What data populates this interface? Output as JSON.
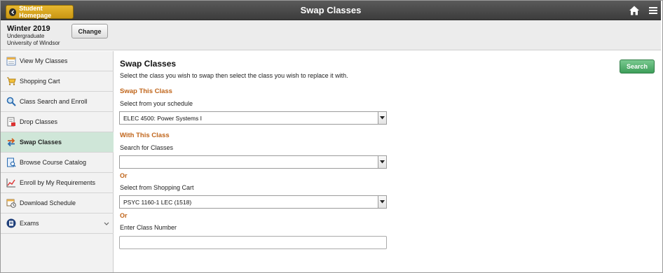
{
  "header": {
    "back_label": "Student Homepage",
    "title": "Swap Classes",
    "home_icon": "home-icon",
    "menu_icon": "hamburger-menu-icon"
  },
  "term": {
    "name": "Winter 2019",
    "career": "Undergraduate",
    "institution": "University of Windsor",
    "change_label": "Change"
  },
  "sidebar": {
    "items": [
      {
        "label": "View My Classes",
        "icon": "calendar-icon"
      },
      {
        "label": "Shopping Cart",
        "icon": "shopping-cart-icon"
      },
      {
        "label": "Class Search and Enroll",
        "icon": "magnifier-icon"
      },
      {
        "label": "Drop Classes",
        "icon": "drop-document-icon"
      },
      {
        "label": "Swap Classes",
        "icon": "swap-arrows-icon",
        "active": true
      },
      {
        "label": "Browse Course Catalog",
        "icon": "catalog-icon"
      },
      {
        "label": "Enroll by My Requirements",
        "icon": "line-chart-icon"
      },
      {
        "label": "Download Schedule",
        "icon": "schedule-clock-icon"
      },
      {
        "label": "Exams",
        "icon": "exams-icon",
        "expandable": true
      }
    ]
  },
  "main": {
    "title": "Swap Classes",
    "search_label": "Search",
    "instructions": "Select the class you wish to swap then select the class you wish to replace it with.",
    "swap_heading": "Swap This Class",
    "schedule_label": "Select from your schedule",
    "schedule_value": "ELEC 4500: Power Systems I",
    "with_heading": "With This Class",
    "search_classes_label": "Search for Classes",
    "search_classes_value": "",
    "or_1": "Or",
    "cart_label": "Select from Shopping Cart",
    "cart_value": "PSYC 1160-1 LEC (1518)",
    "or_2": "Or",
    "class_number_label": "Enter Class Number",
    "class_number_value": ""
  },
  "colors": {
    "header_bg": "#4a4a4a",
    "back_button": "#d9a520",
    "accent_orange": "#c0651a",
    "search_button": "#4caf6a",
    "active_nav": "#cfe6d8"
  }
}
